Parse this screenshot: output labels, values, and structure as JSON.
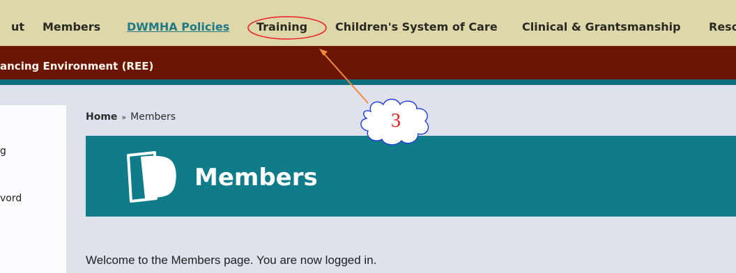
{
  "nav": {
    "items": [
      {
        "label": "ut"
      },
      {
        "label": "Members"
      },
      {
        "label": "DWMHA Policies"
      },
      {
        "label": "Training"
      },
      {
        "label": "Children's System of Care"
      },
      {
        "label": "Clinical & Grantsmanship"
      },
      {
        "label": "Reso"
      }
    ]
  },
  "banner": {
    "text": "ancing Environment (REE)"
  },
  "sidebar": {
    "items": [
      {
        "label": "g"
      },
      {
        "label": "vord"
      }
    ]
  },
  "breadcrumb": {
    "home": "Home",
    "separator": "»",
    "current": "Members"
  },
  "header": {
    "title": "Members",
    "icon": "members-logo-icon"
  },
  "content": {
    "welcome": "Welcome to the Members page. You are now logged in."
  },
  "annotation": {
    "callout_number": "3",
    "color": "#ee1d23",
    "arrow_color": "#f08a3c",
    "cloud_color": "#1f3ad8"
  },
  "colors": {
    "nav_bg": "#ded7a9",
    "banner_bg": "#6b1605",
    "teal": "#107c89",
    "page_bg": "#dfe2ec"
  }
}
